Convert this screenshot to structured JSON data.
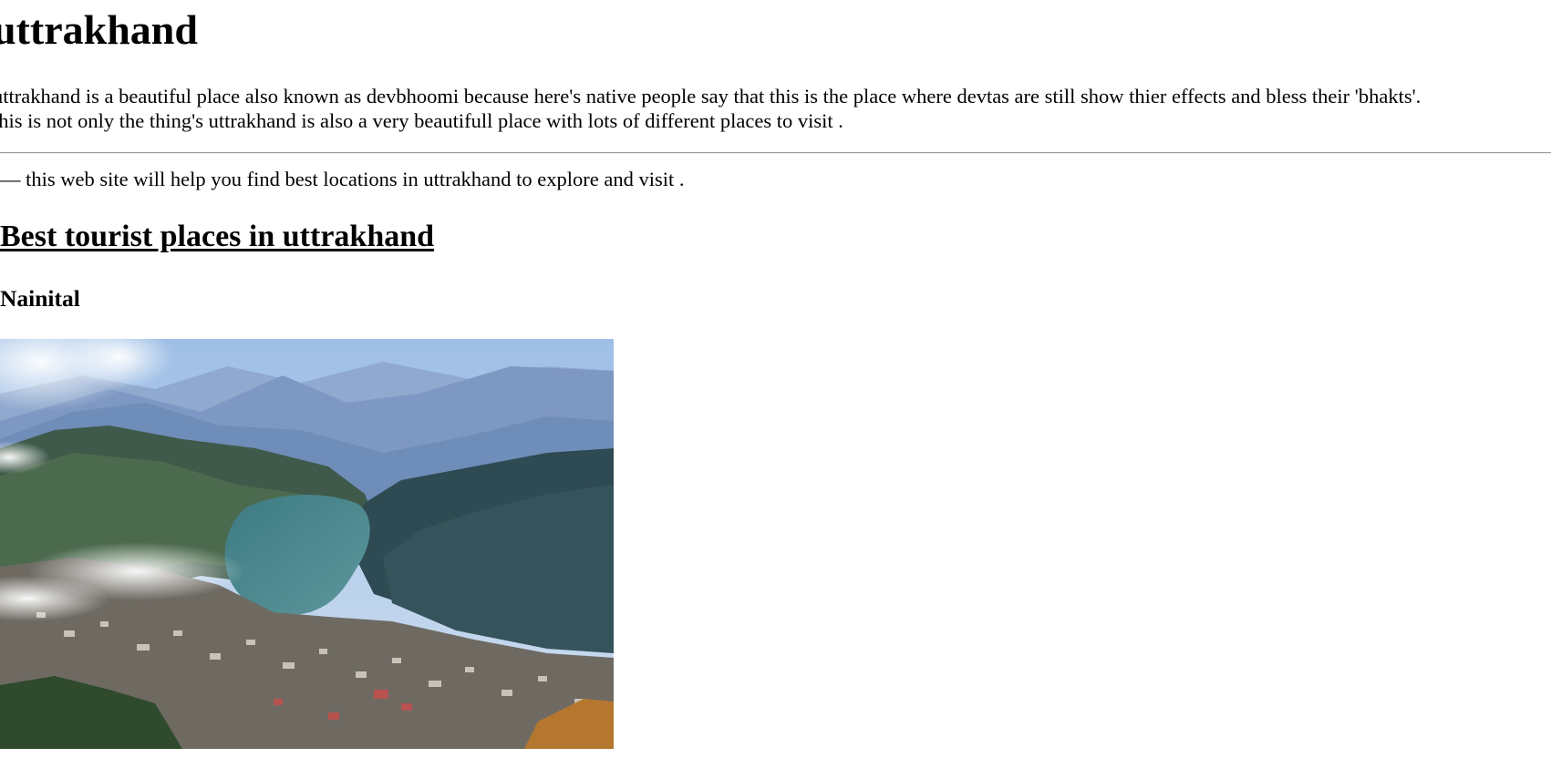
{
  "page": {
    "title": "uttrakhand",
    "intro_lines": [
      "uttrakhand is a beautiful place also known as devbhoomi because here's native people say that this is the place where devtas are still show thier effects and bless their 'bhakts'.",
      "this is not only the thing's uttrakhand is also a very beautifull place with lots of different places to visit ."
    ],
    "tagline": "— this web site will help you find best locations in uttrakhand to explore and visit ."
  },
  "section": {
    "heading": "Best tourist places in uttrakhand",
    "places": [
      {
        "name": "Nainital",
        "image": "nainital-lake-mountain-photo"
      }
    ]
  }
}
